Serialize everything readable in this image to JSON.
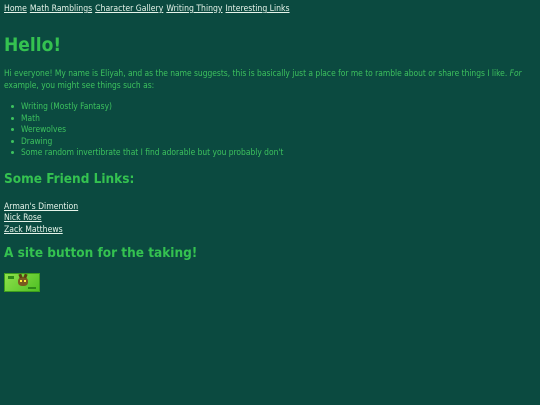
{
  "nav": {
    "links": [
      "Home",
      "Math Ramblings",
      "Character Gallery",
      "Writing Thingy",
      "Interesting Links"
    ]
  },
  "main": {
    "title": "Hello!",
    "intro_before": "Hi everyone! My name is Eliyah, and as the name suggests, this is basically just a place for me to ramble about or share things I like. ",
    "intro_italic": "For",
    "intro_after": " example, you might see things such as:",
    "interests": [
      "Writing (Mostly Fantasy)",
      "Math",
      "Werewolves",
      "Drawing",
      "Some random invertibrate that I find adorable but you probably don't"
    ]
  },
  "friends": {
    "heading": "Some Friend Links:",
    "links": [
      "Arman's Dimention",
      "Nick Rose",
      "Zack Matthews"
    ]
  },
  "site_button": {
    "heading": "A site button for the taking!",
    "icon": "critter-button-icon"
  },
  "colors": {
    "background": "#0b4a40",
    "text": "#3dc25e",
    "link": "#e6f4ea",
    "button": "#6fd23a"
  }
}
